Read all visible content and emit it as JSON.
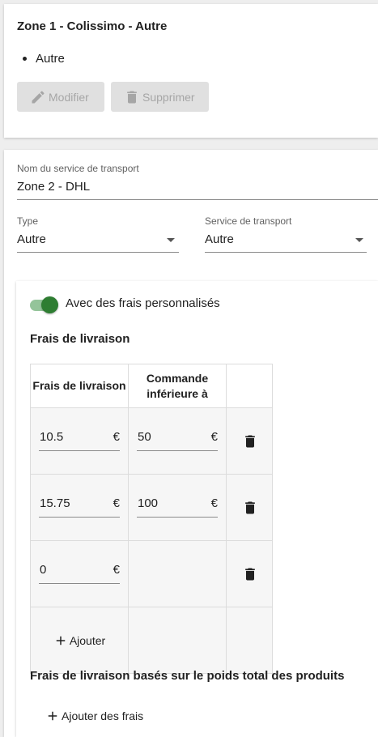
{
  "zone1": {
    "title": "Zone 1 - Colissimo - Autre",
    "items": [
      "Autre"
    ],
    "edit_label": "Modifier",
    "delete_label": "Supprimer"
  },
  "form": {
    "name_label": "Nom du service de transport",
    "name_value": "Zone 2 - DHL",
    "type_label": "Type",
    "type_value": "Autre",
    "service_label": "Service de transport",
    "service_value": "Autre"
  },
  "custom_fees": {
    "toggle_label": "Avec des frais personnalisés",
    "toggle_on": true,
    "section_title": "Frais de livraison",
    "columns": [
      "Frais de livraison",
      "Commande inférieure à"
    ],
    "rows": [
      {
        "fee": "10.5",
        "fee_currency": "€",
        "threshold": "50",
        "threshold_currency": "€"
      },
      {
        "fee": "15.75",
        "fee_currency": "€",
        "threshold": "100",
        "threshold_currency": "€"
      },
      {
        "fee": "0",
        "fee_currency": "€"
      }
    ],
    "add_label": "Ajouter"
  },
  "weight_fees": {
    "section_title": "Frais de livraison basés sur le poids total des produits",
    "add_label": "Ajouter des frais"
  },
  "colors": {
    "toggle_on": "#2e7d32",
    "toggle_track": "#94c49a",
    "disabled_button": "#e0e0e0"
  },
  "icons": [
    "pencil-icon",
    "trash-icon",
    "chevron-down-icon",
    "plus-icon"
  ]
}
